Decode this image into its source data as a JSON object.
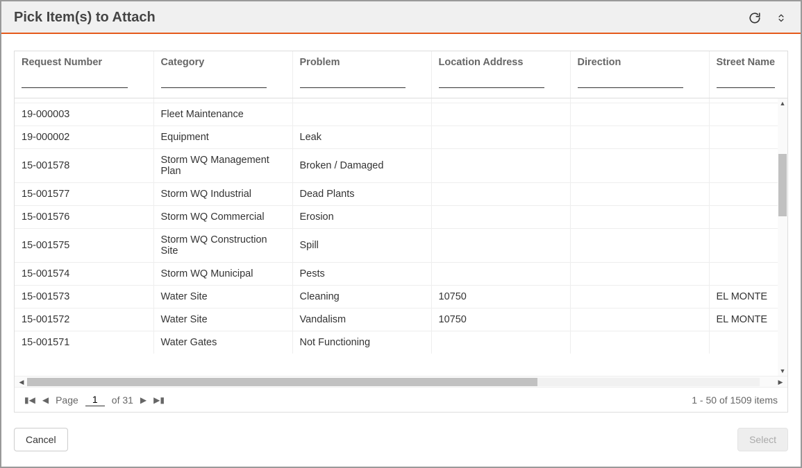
{
  "dialog": {
    "title": "Pick Item(s) to Attach"
  },
  "columns": [
    {
      "key": "request",
      "label": "Request Number"
    },
    {
      "key": "category",
      "label": "Category"
    },
    {
      "key": "problem",
      "label": "Problem"
    },
    {
      "key": "location",
      "label": "Location Address"
    },
    {
      "key": "direction",
      "label": "Direction"
    },
    {
      "key": "street",
      "label": "Street Name"
    }
  ],
  "filters": {
    "request": "",
    "category": "",
    "problem": "",
    "location": "",
    "direction": "",
    "street": ""
  },
  "rows": [
    {
      "request": "19-000003",
      "category": "Fleet Maintenance",
      "problem": "",
      "location": "",
      "direction": "",
      "street": ""
    },
    {
      "request": "19-000002",
      "category": "Equipment",
      "problem": "Leak",
      "location": "",
      "direction": "",
      "street": ""
    },
    {
      "request": "15-001578",
      "category": "Storm WQ Management Plan",
      "problem": "Broken / Damaged",
      "location": "",
      "direction": "",
      "street": ""
    },
    {
      "request": "15-001577",
      "category": "Storm WQ Industrial",
      "problem": "Dead Plants",
      "location": "",
      "direction": "",
      "street": ""
    },
    {
      "request": "15-001576",
      "category": "Storm WQ Commercial",
      "problem": "Erosion",
      "location": "",
      "direction": "",
      "street": ""
    },
    {
      "request": "15-001575",
      "category": "Storm WQ Construction Site",
      "problem": "Spill",
      "location": "",
      "direction": "",
      "street": ""
    },
    {
      "request": "15-001574",
      "category": "Storm WQ Municipal",
      "problem": "Pests",
      "location": "",
      "direction": "",
      "street": ""
    },
    {
      "request": "15-001573",
      "category": "Water Site",
      "problem": "Cleaning",
      "location": "10750",
      "direction": "",
      "street": "EL MONTE"
    },
    {
      "request": "15-001572",
      "category": "Water Site",
      "problem": "Vandalism",
      "location": "10750",
      "direction": "",
      "street": "EL MONTE"
    },
    {
      "request": "15-001571",
      "category": "Water Gates",
      "problem": "Not Functioning",
      "location": "",
      "direction": "",
      "street": ""
    }
  ],
  "pager": {
    "page_label": "Page",
    "current_page": "1",
    "of_label": "of 31",
    "summary": "1 - 50 of 1509 items"
  },
  "footer": {
    "cancel": "Cancel",
    "select": "Select"
  }
}
